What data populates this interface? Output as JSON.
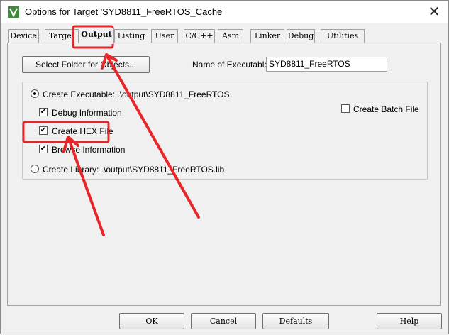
{
  "window": {
    "title": "Options for Target 'SYD8811_FreeRTOS_Cache'",
    "close_glyph": "✕"
  },
  "tabs": [
    {
      "label": "Device"
    },
    {
      "label": "Target"
    },
    {
      "label": "Output",
      "active": true
    },
    {
      "label": "Listing"
    },
    {
      "label": "User"
    },
    {
      "label": "C/C++"
    },
    {
      "label": "Asm"
    },
    {
      "label": "Linker"
    },
    {
      "label": "Debug"
    },
    {
      "label": "Utilities"
    }
  ],
  "output": {
    "select_folder_label": "Select Folder for Objects...",
    "name_exe_label": "Name of Executable:",
    "name_exe_value": "SYD8811_FreeRTOS",
    "create_exe_label": "Create Executable:  .\\output\\SYD8811_FreeRTOS",
    "create_exe_selected": true,
    "debug_info_label": "Debug Information",
    "debug_info_checked": true,
    "create_hex_label": "Create HEX File",
    "create_hex_checked": true,
    "browse_info_label": "Browse Information",
    "browse_info_checked": true,
    "create_batch_label": "Create Batch File",
    "create_batch_checked": false,
    "create_lib_label": "Create Library:  .\\output\\SYD8811_FreeRTOS.lib",
    "create_lib_selected": false
  },
  "buttons": {
    "ok": "OK",
    "cancel": "Cancel",
    "defaults": "Defaults",
    "help": "Help"
  },
  "check_glyph": "✔",
  "annotation_color": "#e8262a",
  "icons": {
    "app": "keil-uvision-icon"
  }
}
